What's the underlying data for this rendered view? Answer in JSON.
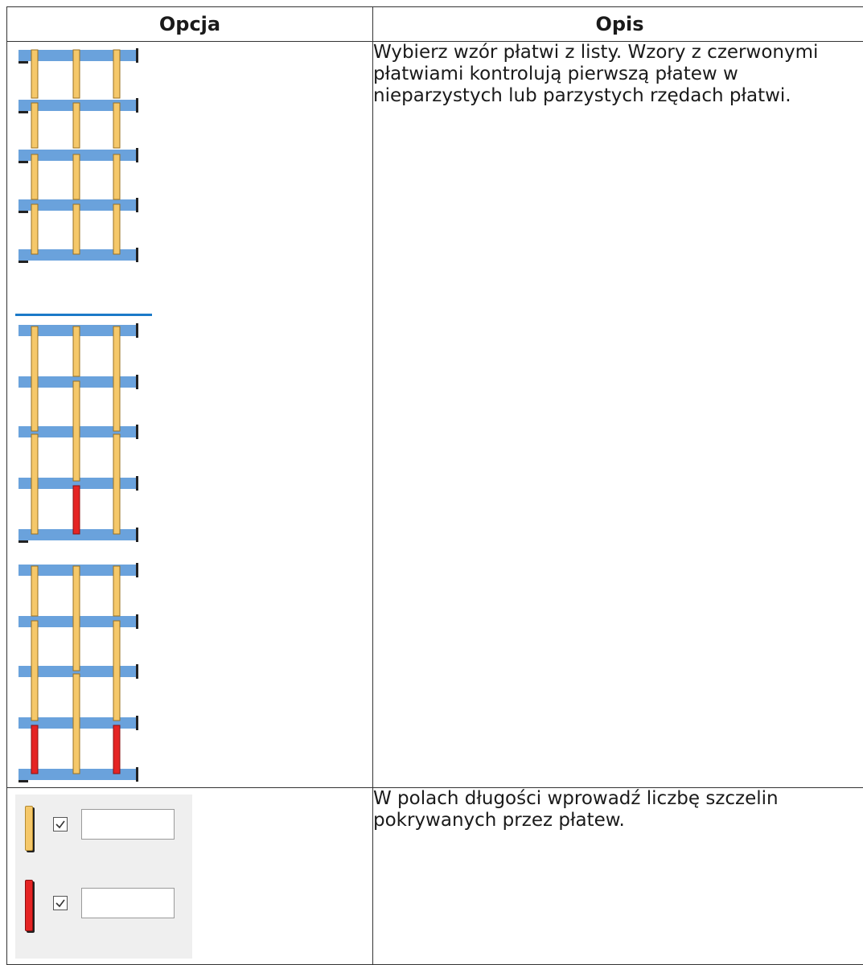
{
  "table": {
    "headers": {
      "option": "Opcja",
      "description": "Opis"
    },
    "rows": [
      {
        "description": "Wybierz wzór płatwi z listy. Wzory z czerwonymi płatwiami kontrolują pierwszą płatew w nieparzystych lub parzystych rzędach płatwi.",
        "icon": "purlin-pattern-list-icons"
      },
      {
        "description": "W polach długości wprowadź liczbę szczelin pokrywanych przez płatew.",
        "icon": "purlin-length-fields",
        "fields": [
          {
            "color": "yellow",
            "checked": true,
            "value": ""
          },
          {
            "color": "red",
            "checked": true,
            "value": ""
          }
        ]
      }
    ]
  },
  "colors": {
    "beam_blue": "#6aa2dc",
    "purlin_yellow": "#f5c86a",
    "purlin_red": "#e52424",
    "separator_blue": "#1b7ac8"
  }
}
